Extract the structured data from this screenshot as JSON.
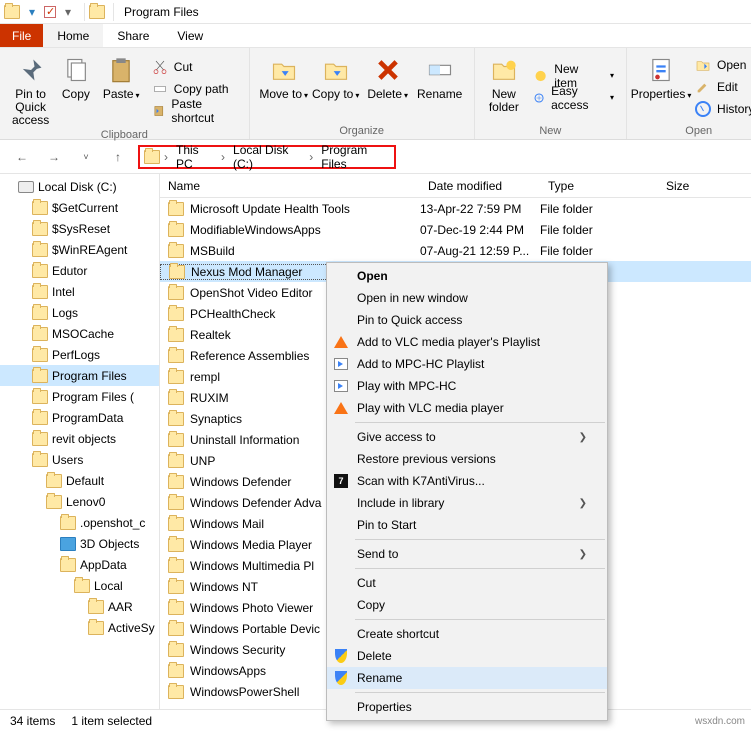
{
  "title": "Program Files",
  "menutabs": {
    "file": "File",
    "home": "Home",
    "share": "Share",
    "view": "View"
  },
  "ribbon": {
    "pin": "Pin to Quick access",
    "copy": "Copy",
    "paste": "Paste",
    "cut": "Cut",
    "copypath": "Copy path",
    "pasteshort": "Paste shortcut",
    "clipboard": "Clipboard",
    "moveto": "Move to",
    "copyto": "Copy to",
    "delete": "Delete",
    "rename": "Rename",
    "organize": "Organize",
    "newfolder": "New folder",
    "newitem": "New item",
    "easyacc": "Easy access",
    "new": "New",
    "properties": "Properties",
    "open": "Open",
    "edit": "Edit",
    "history": "History",
    "openg": "Open"
  },
  "breadcrumbs": [
    "This PC",
    "Local Disk (C:)",
    "Program Files"
  ],
  "treeTop": "Local Disk (C:)",
  "tree": [
    {
      "l": "$GetCurrent",
      "d": 1
    },
    {
      "l": "$SysReset",
      "d": 1
    },
    {
      "l": "$WinREAgent",
      "d": 1
    },
    {
      "l": "Edutor",
      "d": 1
    },
    {
      "l": "Intel",
      "d": 1
    },
    {
      "l": "Logs",
      "d": 1
    },
    {
      "l": "MSOCache",
      "d": 1
    },
    {
      "l": "PerfLogs",
      "d": 1
    },
    {
      "l": "Program Files",
      "d": 1,
      "sel": true
    },
    {
      "l": "Program Files (",
      "d": 1
    },
    {
      "l": "ProgramData",
      "d": 1
    },
    {
      "l": "revit objects",
      "d": 1
    },
    {
      "l": "Users",
      "d": 1
    },
    {
      "l": "Default",
      "d": 2
    },
    {
      "l": "Lenov0",
      "d": 2
    },
    {
      "l": ".openshot_c",
      "d": 3
    },
    {
      "l": "3D Objects",
      "d": 3,
      "k": "blue"
    },
    {
      "l": "AppData",
      "d": 3
    },
    {
      "l": "Local",
      "d": 4
    },
    {
      "l": "AAR",
      "d": 5
    },
    {
      "l": "ActiveSy",
      "d": 5
    }
  ],
  "cols": {
    "name": "Name",
    "date": "Date modified",
    "type": "Type",
    "size": "Size"
  },
  "rows": [
    {
      "n": "Microsoft Update Health Tools",
      "d": "13-Apr-22 7:59 PM",
      "t": "File folder"
    },
    {
      "n": "ModifiableWindowsApps",
      "d": "07-Dec-19 2:44 PM",
      "t": "File folder"
    },
    {
      "n": "MSBuild",
      "d": "07-Aug-21 12:59 P...",
      "t": "File folder"
    },
    {
      "n": "Nexus Mod Manager",
      "d": "",
      "t": "",
      "sel": true
    },
    {
      "n": "OpenShot Video Editor",
      "d": "",
      "t": ""
    },
    {
      "n": "PCHealthCheck",
      "d": "",
      "t": ""
    },
    {
      "n": "Realtek",
      "d": "",
      "t": ""
    },
    {
      "n": "Reference Assemblies",
      "d": "",
      "t": ""
    },
    {
      "n": "rempl",
      "d": "",
      "t": ""
    },
    {
      "n": "RUXIM",
      "d": "",
      "t": ""
    },
    {
      "n": "Synaptics",
      "d": "",
      "t": ""
    },
    {
      "n": "Uninstall Information",
      "d": "",
      "t": ""
    },
    {
      "n": "UNP",
      "d": "",
      "t": ""
    },
    {
      "n": "Windows Defender",
      "d": "",
      "t": ""
    },
    {
      "n": "Windows Defender Adva",
      "d": "",
      "t": ""
    },
    {
      "n": "Windows Mail",
      "d": "",
      "t": ""
    },
    {
      "n": "Windows Media Player",
      "d": "",
      "t": ""
    },
    {
      "n": "Windows Multimedia Pl",
      "d": "",
      "t": ""
    },
    {
      "n": "Windows NT",
      "d": "",
      "t": ""
    },
    {
      "n": "Windows Photo Viewer",
      "d": "",
      "t": ""
    },
    {
      "n": "Windows Portable Devic",
      "d": "",
      "t": ""
    },
    {
      "n": "Windows Security",
      "d": "",
      "t": ""
    },
    {
      "n": "WindowsApps",
      "d": "",
      "t": ""
    },
    {
      "n": "WindowsPowerShell",
      "d": "",
      "t": ""
    }
  ],
  "ctx": {
    "open": "Open",
    "newwin": "Open in new window",
    "pin": "Pin to Quick access",
    "vlcadd": "Add to VLC media player's Playlist",
    "mpcadd": "Add to MPC-HC Playlist",
    "mpc": "Play with MPC-HC",
    "vlc": "Play with VLC media player",
    "give": "Give access to",
    "restore": "Restore previous versions",
    "k7": "Scan with K7AntiVirus...",
    "lib": "Include in library",
    "pinstart": "Pin to Start",
    "send": "Send to",
    "cut": "Cut",
    "copy": "Copy",
    "shortcut": "Create shortcut",
    "del": "Delete",
    "ren": "Rename",
    "prop": "Properties"
  },
  "status": {
    "items": "34 items",
    "sel": "1 item selected"
  },
  "watermark": "wsxdn.com"
}
